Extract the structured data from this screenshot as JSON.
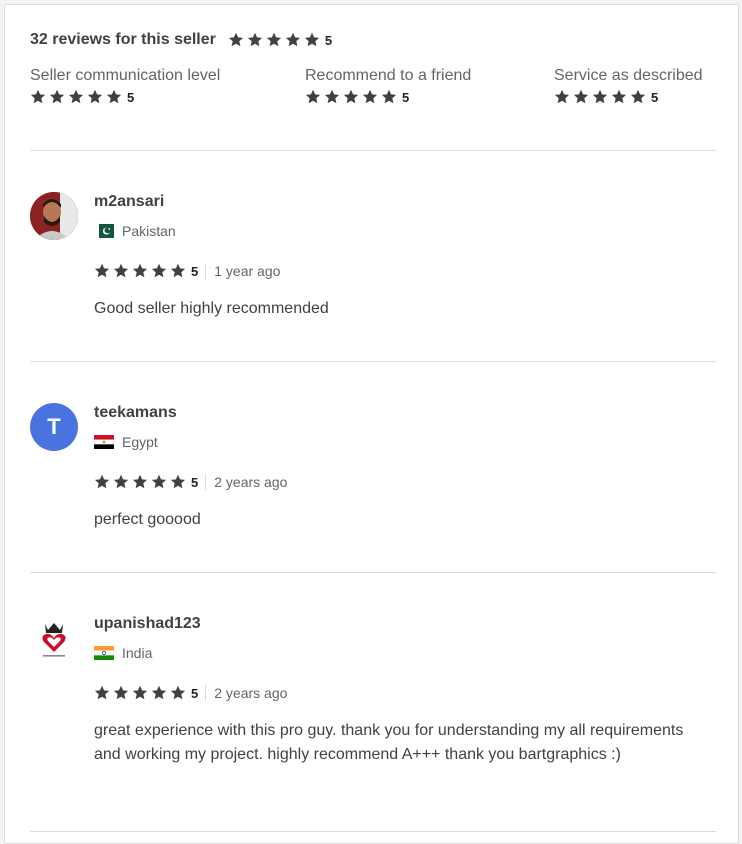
{
  "summary": {
    "title": "32 reviews for this seller",
    "rating": "5",
    "breakdown": [
      {
        "label": "Seller communication level",
        "rating": "5"
      },
      {
        "label": "Recommend to a friend",
        "rating": "5"
      },
      {
        "label": "Service as described",
        "rating": "5"
      }
    ]
  },
  "reviews": [
    {
      "username": "m2ansari",
      "country": "Pakistan",
      "rating": "5",
      "time": "1 year ago",
      "text": "Good seller highly recommended",
      "avatar": "photo"
    },
    {
      "username": "teekamans",
      "country": "Egypt",
      "rating": "5",
      "time": "2 years ago",
      "text": "perfect gooood",
      "avatar_letter": "T"
    },
    {
      "username": "upanishad123",
      "country": "India",
      "rating": "5",
      "time": "2 years ago",
      "text": "great experience with this pro guy. thank you for understanding my all requirements and working my project. highly recommend A+++ thank you bartgraphics :)",
      "avatar": "logo"
    }
  ],
  "colors": {
    "star": "#404145",
    "text": "#404145",
    "muted": "#62646a",
    "divider": "#dadbdd",
    "avatar_letter_bg": "#4b73e0"
  },
  "icons": {
    "star": "star-icon"
  }
}
